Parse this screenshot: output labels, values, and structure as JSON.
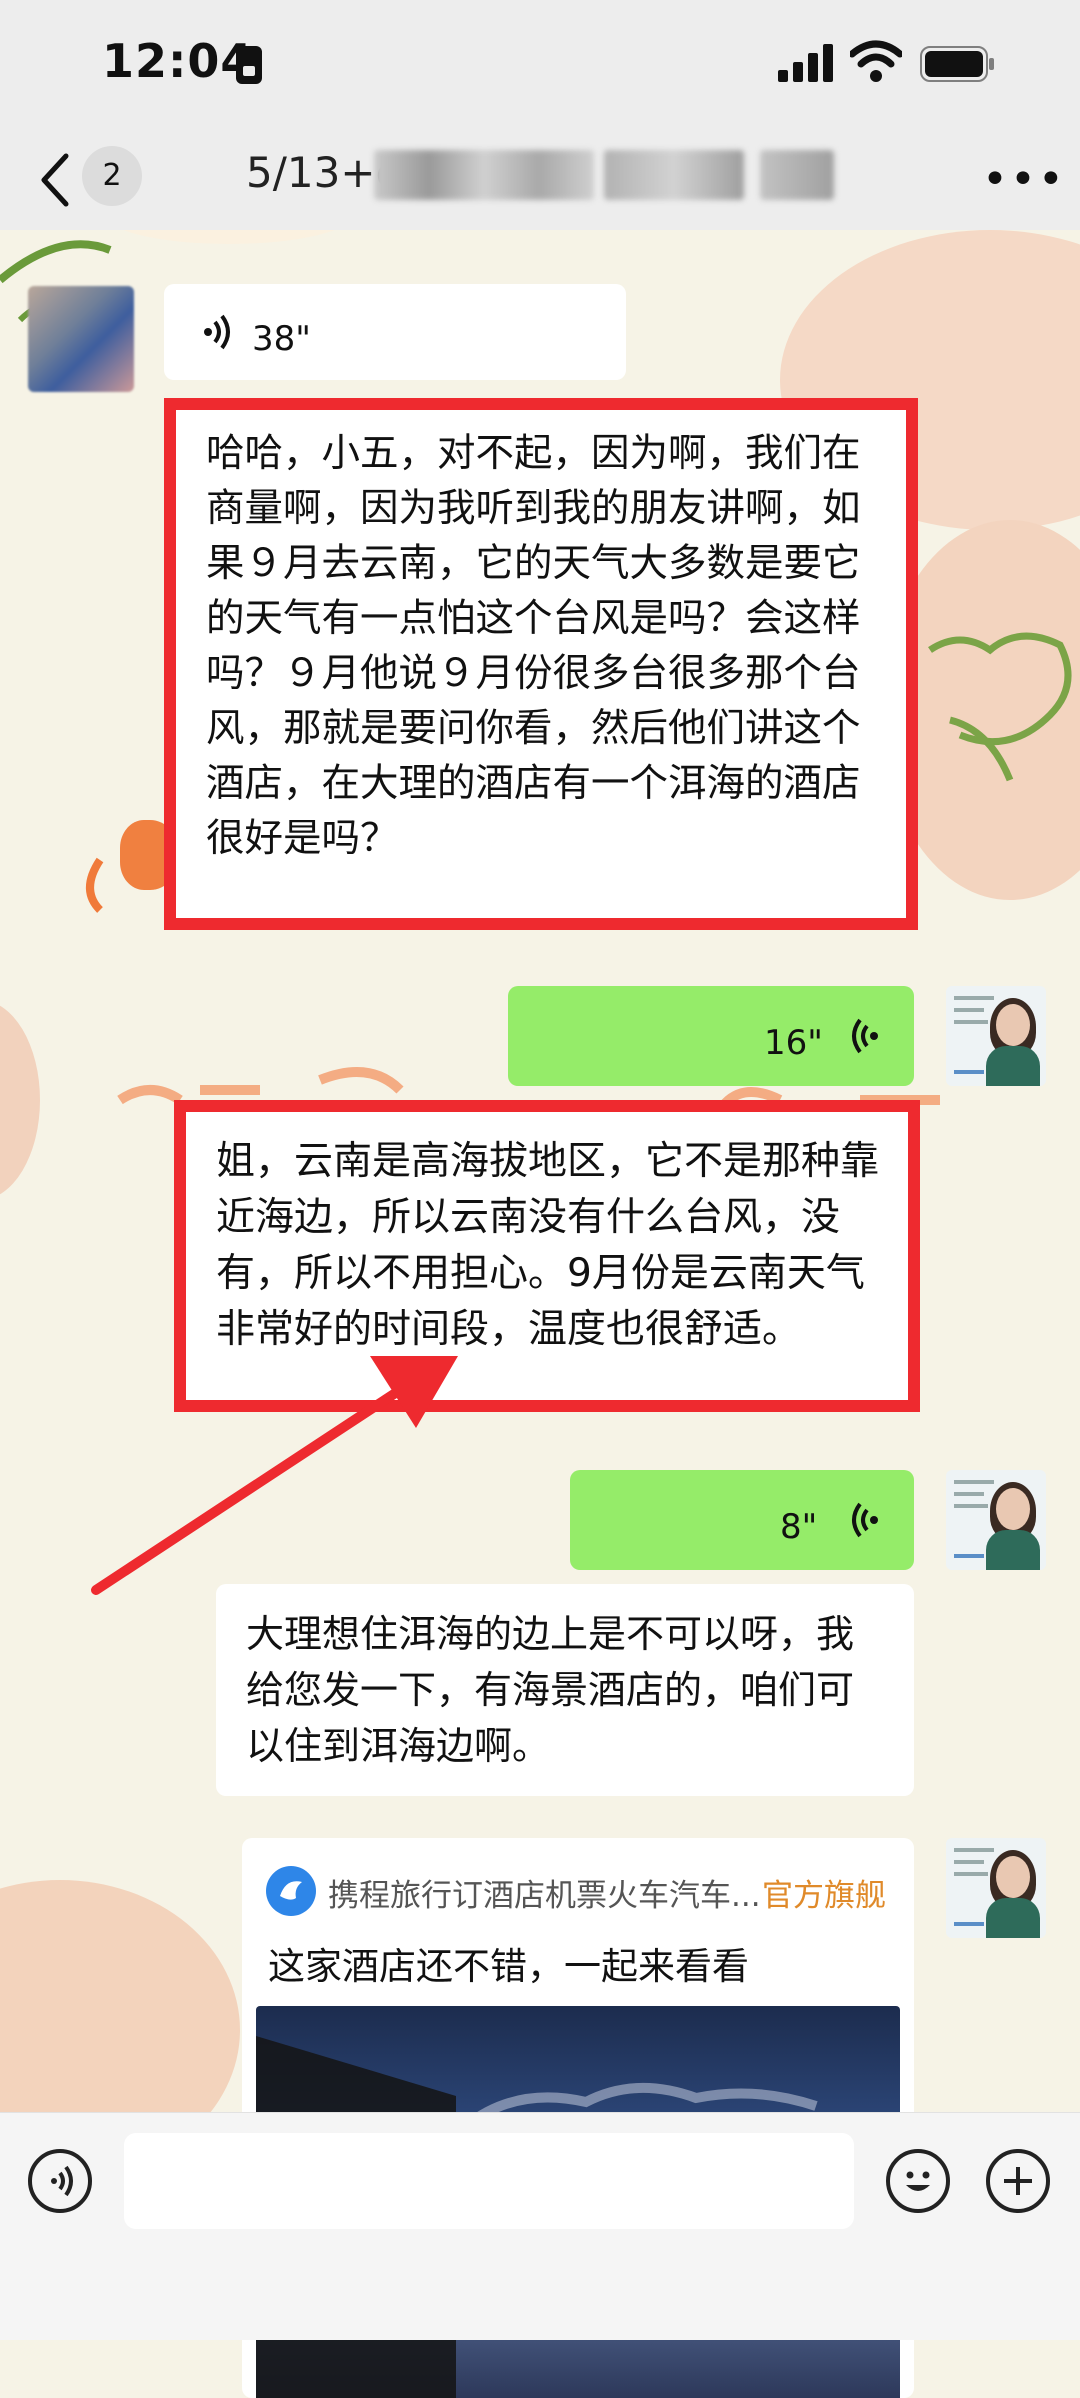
{
  "status_bar": {
    "time": "12:04"
  },
  "nav": {
    "unread_count": "2",
    "title": "5/13+c"
  },
  "messages": {
    "voice_in_1": {
      "duration": "38\""
    },
    "text_in_1": "哈哈，小五，对不起，因为啊，我们在商量啊，因为我听到我的朋友讲啊，如果９月去云南，它的天气大多数是要它的天气有一点怕这个台风是吗？会这样吗？９月他说９月份很多台很多那个台风，那就是要问你看，然后他们讲这个酒店，在大理的酒店有一个洱海的酒店很好是吗？",
    "voice_out_1": {
      "duration": "16\""
    },
    "text_out_1": "姐，云南是高海拔地区，它不是那种靠近海边，所以云南没有什么台风，没有，所以不用担心。9月份是云南天气非常好的时间段，温度也很舒适。",
    "voice_out_2": {
      "duration": "8\""
    },
    "text_out_2": "大理想住洱海的边上是不可以呀，我给您发一下，有海景酒店的，咱们可以住到洱海边啊。",
    "card": {
      "source": "携程旅行订酒店机票火车汽车...",
      "tag": "官方旗舰",
      "title": "这家酒店还不错，一起来看看"
    }
  },
  "colors": {
    "highlight": "#ee2a2f",
    "outgoing": "#95ec69",
    "incoming": "#ffffff"
  }
}
